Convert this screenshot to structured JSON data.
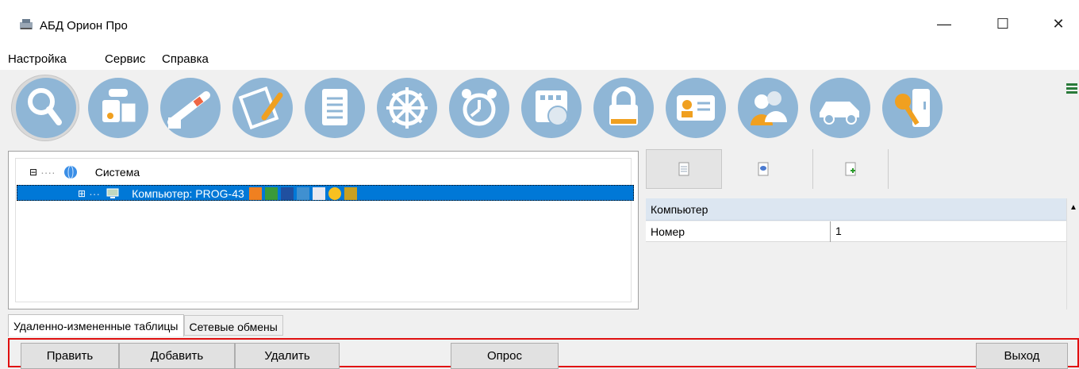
{
  "window": {
    "title": "АБД Орион Про",
    "minimize": "—",
    "maximize": "☐",
    "close": "✕"
  },
  "menu": {
    "items": [
      "Настройка",
      "Сервис",
      "Справка"
    ]
  },
  "toolbar": {
    "tools": [
      {
        "name": "search-icon"
      },
      {
        "name": "device-icon"
      },
      {
        "name": "barrier-icon"
      },
      {
        "name": "plan-edit-icon"
      },
      {
        "name": "document-icon"
      },
      {
        "name": "wheel-icon"
      },
      {
        "name": "alarm-clock-icon"
      },
      {
        "name": "schedule-icon"
      },
      {
        "name": "lock-icon"
      },
      {
        "name": "id-card-icon"
      },
      {
        "name": "people-icon"
      },
      {
        "name": "car-icon"
      },
      {
        "name": "key-icon"
      }
    ],
    "accent": "#8fb6d6"
  },
  "tree": {
    "root": {
      "label": "Система",
      "expander": "⊟"
    },
    "child": {
      "label": "Компьютер: PROG-43",
      "expander": "⊞"
    }
  },
  "properties": {
    "header": "Компьютер",
    "rows": [
      {
        "key": "Номер",
        "value": "1"
      }
    ]
  },
  "tabs": [
    "Удаленно-измененные таблицы",
    "Сетевые обмены"
  ],
  "buttons": {
    "edit": "Править",
    "add": "Добавить",
    "delete": "Удалить",
    "poll": "Опрос",
    "exit": "Выход"
  },
  "colors": {
    "selection": "#0078d7",
    "highlight_border": "#e01010"
  }
}
